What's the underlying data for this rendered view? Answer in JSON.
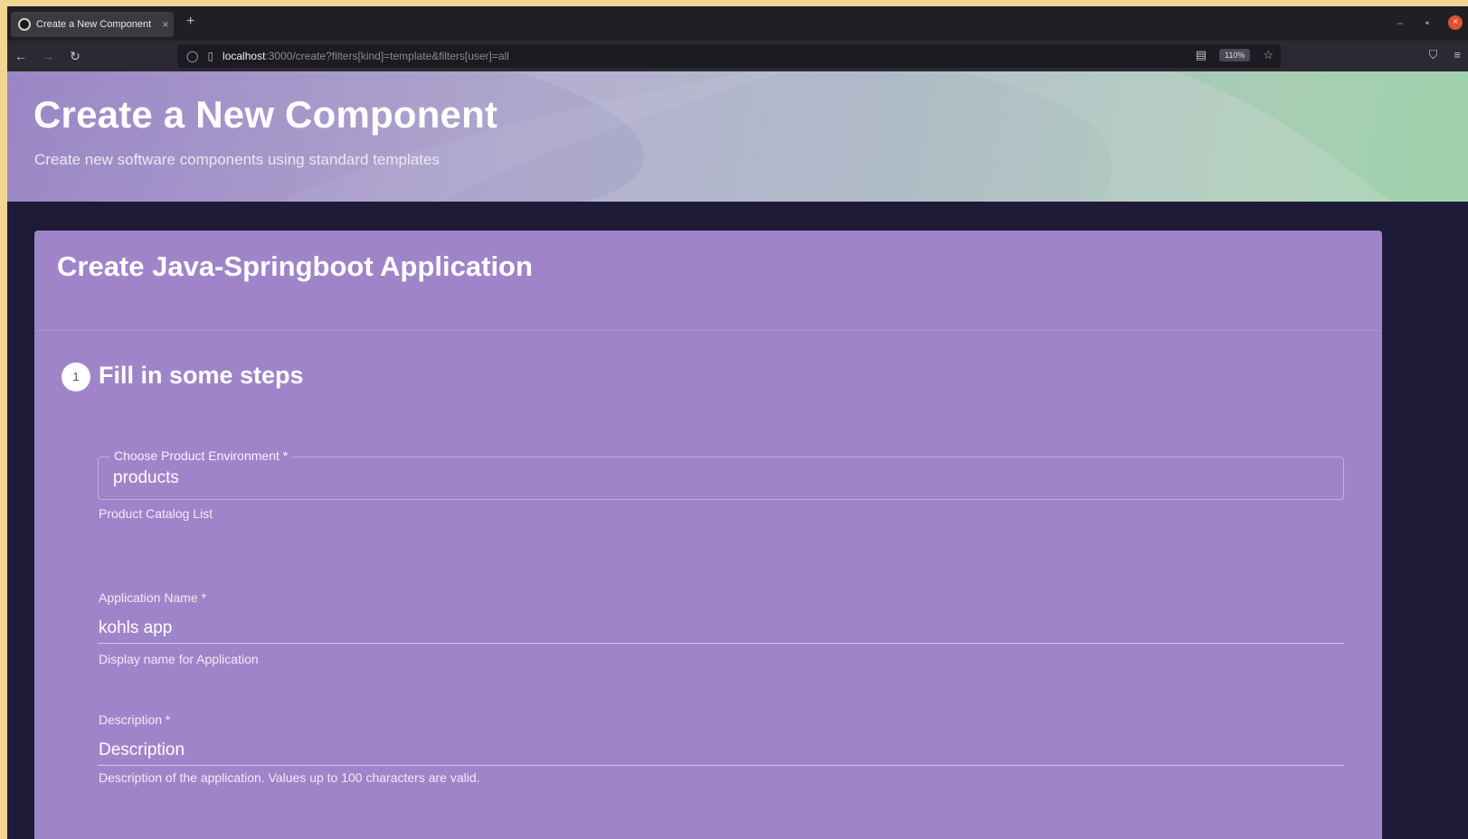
{
  "browser": {
    "tab_title": "Create a New Component",
    "tab_close": "×",
    "new_tab": "+",
    "url_host": "localhost",
    "url_path": ":3000/create?filters[kind]=template&filters[user]=all",
    "zoom": "110%",
    "icons": {
      "back": "back-arrow-icon",
      "forward": "forward-arrow-icon",
      "reload": "reload-icon",
      "shield": "shield-icon",
      "page": "page-icon",
      "reader": "reader-view-icon",
      "bookmark": "star-icon",
      "pocket": "pocket-icon",
      "menu": "hamburger-menu-icon"
    }
  },
  "hero": {
    "title": "Create a New Component",
    "subtitle": "Create new software components using standard templates"
  },
  "card": {
    "title": "Create Java-Springboot Application",
    "step_number": "1",
    "step_label": "Fill in some steps"
  },
  "form": {
    "environment": {
      "label": "Choose Product Environment *",
      "value": "products",
      "helper": "Product Catalog List"
    },
    "app_name": {
      "label": "Application Name *",
      "value": "kohls app",
      "helper": "Display name for Application"
    },
    "description": {
      "label": "Description *",
      "placeholder": "Description",
      "helper": "Description of the application. Values up to 100 characters are valid."
    }
  },
  "colors": {
    "card_bg": "#a084c9",
    "page_bg": "#1e1b38",
    "hero_start": "#9a87c6",
    "hero_end": "#98cfa5"
  }
}
